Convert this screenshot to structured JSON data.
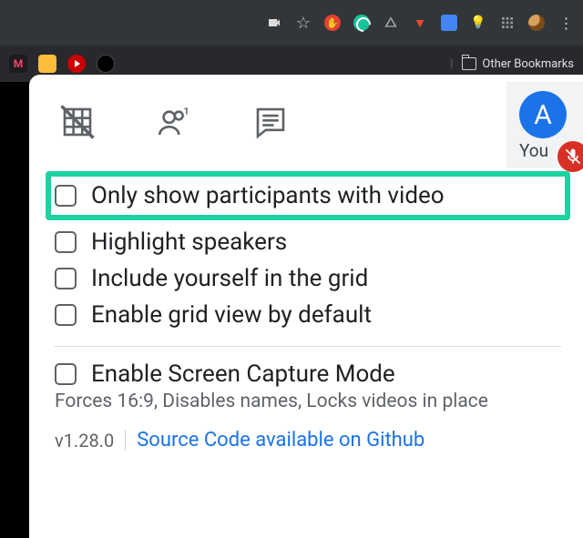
{
  "browser": {
    "star": "☆",
    "other_bookmarks": "Other Bookmarks"
  },
  "panel": {
    "you_label": "You",
    "avatar_letter": "A",
    "options": {
      "only_video": "Only show participants with video",
      "highlight_speakers": "Highlight speakers",
      "include_self": "Include yourself in the grid",
      "enable_default": "Enable grid view by default",
      "screen_capture": "Enable Screen Capture Mode",
      "screen_capture_sub": "Forces 16:9, Disables names, Locks videos in place"
    },
    "version": "v1.28.0",
    "source_link": "Source Code available on Github"
  }
}
